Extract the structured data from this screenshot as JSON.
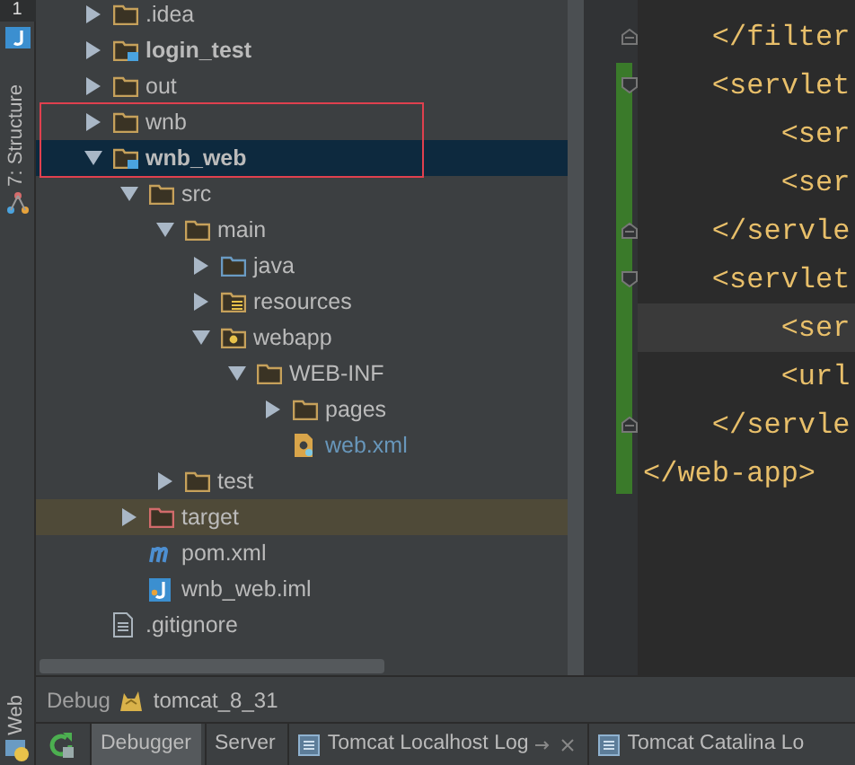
{
  "left_strip": {
    "top_tab": "1",
    "structure_tab": "7: Structure",
    "web_tab": "Web"
  },
  "tree": [
    {
      "label": ".idea",
      "kind": "folder",
      "expanded": false,
      "selected": false
    },
    {
      "label": "login_test",
      "kind": "module",
      "expanded": false,
      "selected": false
    },
    {
      "label": "out",
      "kind": "folder",
      "expanded": false,
      "selected": false
    },
    {
      "label": "wnb",
      "kind": "folder",
      "expanded": false,
      "selected": false
    },
    {
      "label": "wnb_web",
      "kind": "module",
      "expanded": true,
      "selected": true,
      "children": [
        {
          "label": "src",
          "kind": "folder",
          "expanded": true,
          "selected": false,
          "children": [
            {
              "label": "main",
              "kind": "folder",
              "expanded": true,
              "selected": false,
              "children": [
                {
                  "label": "java",
                  "kind": "source",
                  "expanded": false,
                  "selected": false
                },
                {
                  "label": "resources",
                  "kind": "resource",
                  "expanded": false,
                  "selected": false
                },
                {
                  "label": "webapp",
                  "kind": "web",
                  "expanded": true,
                  "selected": false,
                  "children": [
                    {
                      "label": "WEB-INF",
                      "kind": "folder",
                      "expanded": true,
                      "selected": false,
                      "children": [
                        {
                          "label": "pages",
                          "kind": "folder",
                          "expanded": false,
                          "selected": false
                        },
                        {
                          "label": "web.xml",
                          "kind": "xml",
                          "selected": false,
                          "modified": true
                        }
                      ]
                    }
                  ]
                }
              ]
            },
            {
              "label": "test",
              "kind": "folder",
              "expanded": false,
              "selected": false
            }
          ]
        },
        {
          "label": "target",
          "kind": "excluded",
          "expanded": false,
          "selected": false,
          "highlighted": true
        },
        {
          "label": "pom.xml",
          "kind": "maven",
          "selected": false
        },
        {
          "label": "wnb_web.iml",
          "kind": "iml",
          "selected": false
        }
      ]
    },
    {
      "label": ".gitignore",
      "kind": "text",
      "selected": false
    }
  ],
  "code_lines": [
    {
      "text": "    </filter",
      "fold_end": true
    },
    {
      "text": "    <servlet",
      "fold_start": true
    },
    {
      "text": "        <ser"
    },
    {
      "text": "        <ser"
    },
    {
      "text": "    </servle",
      "fold_end": true
    },
    {
      "text": "    <servlet",
      "fold_start": true
    },
    {
      "text": "        <ser",
      "current": true
    },
    {
      "text": "        <url"
    },
    {
      "text": "    </servle",
      "fold_end": true
    },
    {
      "text": "</web-app>"
    }
  ],
  "debug_bar": {
    "label": "Debug",
    "config": "tomcat_8_31"
  },
  "debug_tabs": [
    {
      "label": "Debugger",
      "kind": "plain",
      "selected": true
    },
    {
      "label": "Server",
      "kind": "plain",
      "selected": false
    },
    {
      "label": "Tomcat Localhost Log",
      "kind": "log",
      "selected": false,
      "closable": true
    },
    {
      "label": "Tomcat Catalina Lo",
      "kind": "log",
      "selected": false
    }
  ]
}
